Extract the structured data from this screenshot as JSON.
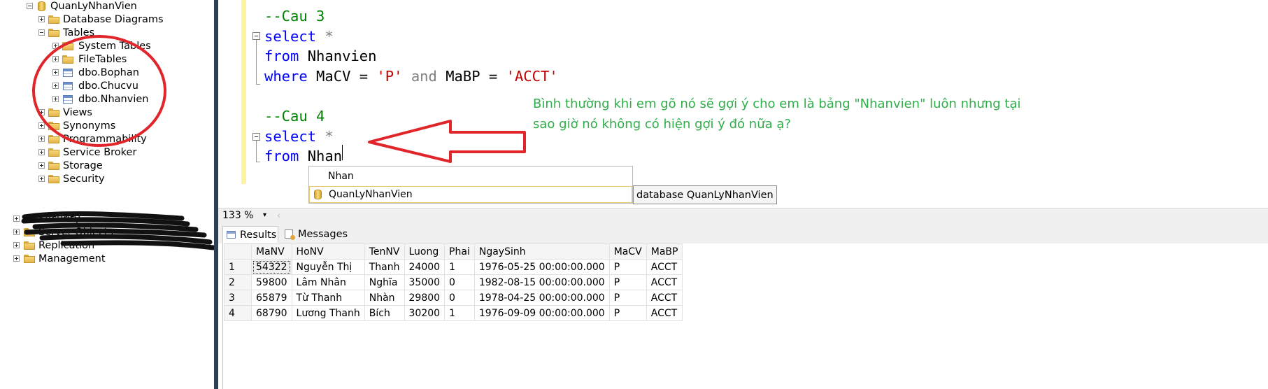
{
  "explorer": {
    "db_label": "QuanLyNhanVien",
    "database_diagrams": "Database Diagrams",
    "tables": "Tables",
    "system_tables": "System Tables",
    "file_tables": "FileTables",
    "bophan": "dbo.Bophan",
    "chucvu": "dbo.Chucvu",
    "nhanvien": "dbo.Nhanvien",
    "views": "Views",
    "synonyms": "Synonyms",
    "programmability": "Programmability",
    "service_broker": "Service Broker",
    "storage": "Storage",
    "security": "Security",
    "server_security": "Security",
    "server_objects": "Server Objects",
    "replication": "Replication",
    "management": "Management"
  },
  "editor": {
    "cau3_comment": "--Cau 3",
    "select_kw": "select",
    "star": " *",
    "from_kw": "from",
    "nhanvien_tbl": " Nhanvien",
    "where_kw": "where",
    "macv": " MaCV = ",
    "p_value": "'P'",
    "and_kw": " and ",
    "mabp": "MaBP = ",
    "acct_value": "'ACCT'",
    "cau4_comment": "--Cau 4",
    "select2_kw": "select",
    "star2": " *",
    "from2_kw": "from",
    "typed": " Nhan"
  },
  "note": {
    "line1": "Bình thường khi em gõ nó sẽ gợi ý cho em là bảng \"Nhanvien\" luôn nhưng tại",
    "line2": "sao giờ nó không có hiện gợi ý đó nữa ạ?"
  },
  "autocomplete": {
    "header": "Nhan",
    "item": "QuanLyNhanVien",
    "tooltip": "database QuanLyNhanVien"
  },
  "zoom": {
    "value": "133 %"
  },
  "tabs": {
    "results": "Results",
    "messages": "Messages"
  },
  "grid": {
    "columns": [
      "MaNV",
      "HoNV",
      "TenNV",
      "Luong",
      "Phai",
      "NgaySinh",
      "MaCV",
      "MaBP"
    ],
    "rows": [
      {
        "n": "1",
        "MaNV": "54322",
        "HoNV": "Nguyễn Thị",
        "TenNV": "Thanh",
        "Luong": "24000",
        "Phai": "1",
        "NgaySinh": "1976-05-25 00:00:00.000",
        "MaCV": "P",
        "MaBP": "ACCT"
      },
      {
        "n": "2",
        "MaNV": "59800",
        "HoNV": "Lâm Nhân",
        "TenNV": "Nghĩa",
        "Luong": "35000",
        "Phai": "0",
        "NgaySinh": "1982-08-15 00:00:00.000",
        "MaCV": "P",
        "MaBP": "ACCT"
      },
      {
        "n": "3",
        "MaNV": "65879",
        "HoNV": "Từ Thanh",
        "TenNV": "Nhàn",
        "Luong": "29800",
        "Phai": "0",
        "NgaySinh": "1978-04-25 00:00:00.000",
        "MaCV": "P",
        "MaBP": "ACCT"
      },
      {
        "n": "4",
        "MaNV": "68790",
        "HoNV": "Lương Thanh",
        "TenNV": "Bích",
        "Luong": "30200",
        "Phai": "1",
        "NgaySinh": "1976-09-09 00:00:00.000",
        "MaCV": "P",
        "MaBP": "ACCT"
      }
    ]
  },
  "colors": {
    "keyword": "#0000ff",
    "comment": "#008000",
    "string": "#c00000",
    "note_text": "#2fae4a",
    "annotation_red": "#e0252b"
  }
}
